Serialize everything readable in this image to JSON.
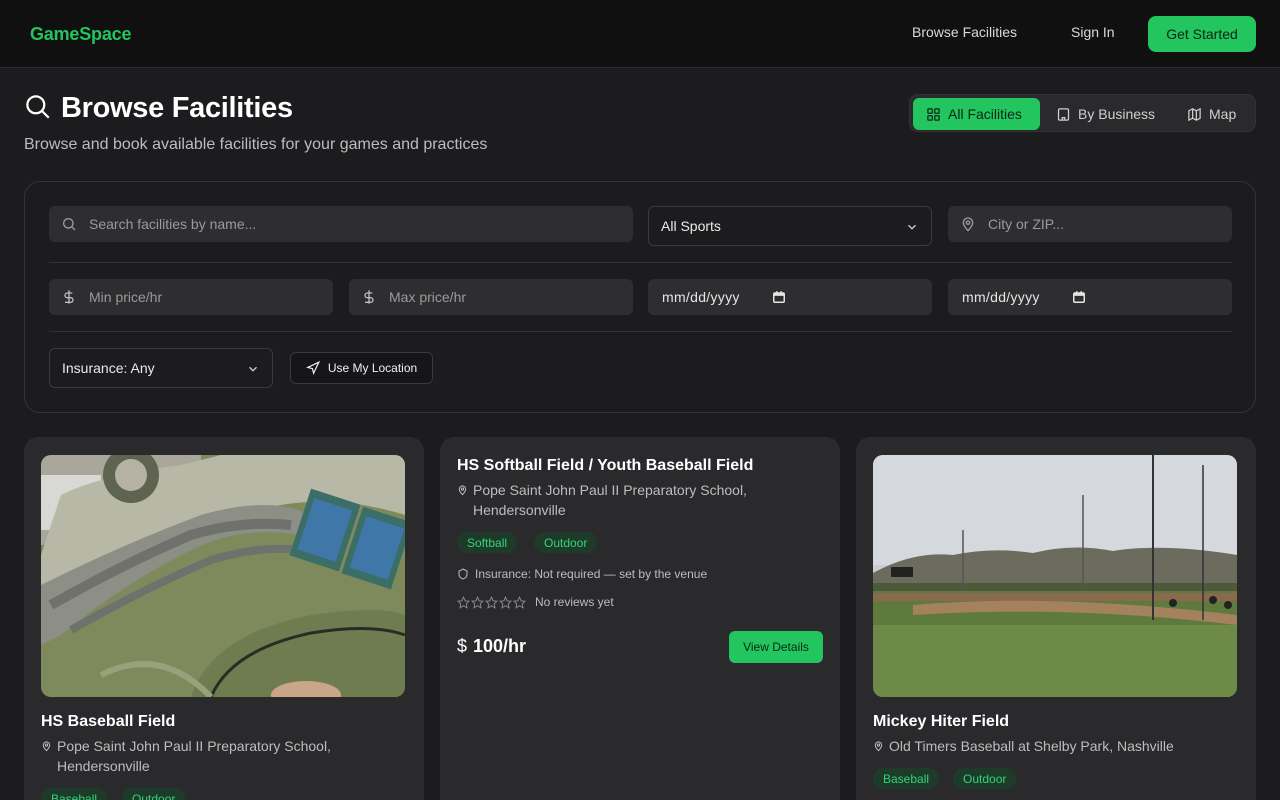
{
  "brand": {
    "name": "GameSpace",
    "color": "#22c55e"
  },
  "nav": {
    "browse": "Browse Facilities",
    "signin": "Sign In",
    "cta": "Get Started"
  },
  "header": {
    "title": "Browse Facilities",
    "subtitle": "Browse and book available facilities for your games and practices",
    "views": [
      {
        "label": "All Facilities",
        "icon": "grid-icon",
        "active": true
      },
      {
        "label": "By Business",
        "icon": "building-icon",
        "active": false
      },
      {
        "label": "Map",
        "icon": "map-icon",
        "active": false
      }
    ]
  },
  "filters": {
    "search_placeholder": "Search facilities by name...",
    "sport_value": "All Sports",
    "location_placeholder": "City or ZIP...",
    "min_price_placeholder": "Min price/hr",
    "max_price_placeholder": "Max price/hr",
    "start_date": "mm/dd/yyyy",
    "end_date": "mm/dd/yyyy",
    "insurance_value": "Insurance: Any",
    "use_location": "Use My Location"
  },
  "cards": [
    {
      "title": "HS Baseball Field",
      "location": "Pope Saint John Paul II Preparatory School, Hendersonville",
      "tags": [
        "Baseball",
        "Outdoor"
      ],
      "image_label": "Pope Saint John Paul II Preparatory..."
    },
    {
      "title": "HS Softball Field / Youth Baseball Field",
      "location": "Pope Saint John Paul II Preparatory School, Hendersonville",
      "tags": [
        "Softball",
        "Outdoor"
      ],
      "insurance": "Insurance: Not required — set by the venue",
      "reviews": "No reviews yet",
      "rating": 0,
      "price": "100/hr",
      "currency": "$",
      "action": "View Details"
    },
    {
      "title": "Mickey Hiter Field",
      "location": "Old Timers Baseball at Shelby Park, Nashville",
      "tags": [
        "Baseball",
        "Outdoor"
      ]
    }
  ]
}
